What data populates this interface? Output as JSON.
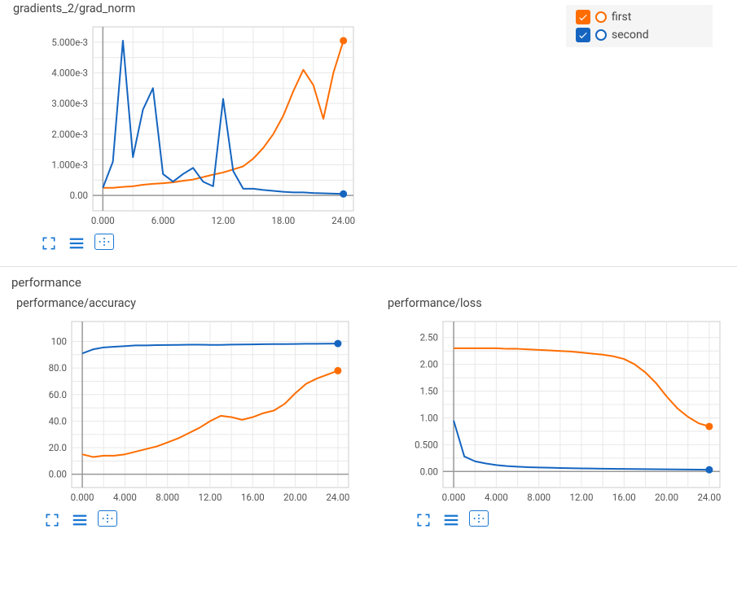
{
  "legend": {
    "items": [
      {
        "label": "first",
        "color": "#ff6d00"
      },
      {
        "label": "second",
        "color": "#1565c0"
      }
    ]
  },
  "section2_title": "performance",
  "chart_data": [
    {
      "id": "grad",
      "title": "gradients_2/grad_norm",
      "type": "line",
      "xlim": [
        -1,
        25
      ],
      "ylim": [
        -0.0005,
        0.0055
      ],
      "xticks_raw": [
        0,
        6,
        12,
        18,
        24
      ],
      "xticks_label": [
        "0.000",
        "6.000",
        "12.00",
        "18.00",
        "24.00"
      ],
      "yticks_raw": [
        0,
        0.001,
        0.002,
        0.003,
        0.004,
        0.005
      ],
      "yticks_label": [
        "0.00",
        "1.000e-3",
        "2.000e-3",
        "3.000e-3",
        "4.000e-3",
        "5.000e-3"
      ],
      "x": [
        0,
        1,
        2,
        3,
        4,
        5,
        6,
        7,
        8,
        9,
        10,
        11,
        12,
        13,
        14,
        15,
        16,
        17,
        18,
        19,
        20,
        21,
        22,
        23,
        24
      ],
      "series": [
        {
          "name": "first",
          "color": "#ff6d00",
          "values": [
            0.00025,
            0.00025,
            0.00028,
            0.0003,
            0.00035,
            0.00038,
            0.0004,
            0.00043,
            0.00048,
            0.00052,
            0.0006,
            0.00068,
            0.00075,
            0.00085,
            0.00095,
            0.0012,
            0.00155,
            0.002,
            0.0026,
            0.0034,
            0.0041,
            0.0036,
            0.0025,
            0.004,
            0.00505
          ]
        },
        {
          "name": "second",
          "color": "#1565c0",
          "values": [
            0.00025,
            0.0011,
            0.00505,
            0.00125,
            0.0028,
            0.0035,
            0.0007,
            0.00045,
            0.0007,
            0.0009,
            0.00045,
            0.0003,
            0.00315,
            0.0008,
            0.00022,
            0.00022,
            0.00018,
            0.00015,
            0.00012,
            0.0001,
            0.0001,
            8e-05,
            7e-05,
            6e-05,
            5e-05
          ]
        }
      ]
    },
    {
      "id": "acc",
      "title": "performance/accuracy",
      "type": "line",
      "xlim": [
        -1,
        25
      ],
      "ylim": [
        -10,
        115
      ],
      "xticks_raw": [
        0,
        4,
        8,
        12,
        16,
        20,
        24
      ],
      "xticks_label": [
        "0.000",
        "4.000",
        "8.000",
        "12.00",
        "16.00",
        "20.00",
        "24.00"
      ],
      "yticks_raw": [
        0,
        20,
        40,
        60,
        80,
        100
      ],
      "yticks_label": [
        "0.00",
        "20.0",
        "40.0",
        "60.0",
        "80.0",
        "100"
      ],
      "x": [
        0,
        1,
        2,
        3,
        4,
        5,
        6,
        7,
        8,
        9,
        10,
        11,
        12,
        13,
        14,
        15,
        16,
        17,
        18,
        19,
        20,
        21,
        22,
        23,
        24
      ],
      "series": [
        {
          "name": "first",
          "color": "#ff6d00",
          "values": [
            15,
            13,
            14,
            14,
            15,
            17,
            19,
            21,
            24,
            27,
            31,
            35,
            40,
            44,
            43,
            41,
            43,
            46,
            48,
            53,
            61,
            68,
            72,
            75,
            78
          ]
        },
        {
          "name": "second",
          "color": "#1565c0",
          "values": [
            91,
            94,
            95.5,
            96,
            96.5,
            97,
            97,
            97.2,
            97.3,
            97.4,
            97.5,
            97.5,
            97.4,
            97.4,
            97.6,
            97.7,
            97.8,
            97.9,
            98,
            98,
            98.1,
            98.2,
            98.2,
            98.3,
            98.4
          ]
        }
      ]
    },
    {
      "id": "loss",
      "title": "performance/loss",
      "type": "line",
      "xlim": [
        -1,
        25
      ],
      "ylim": [
        -0.3,
        2.8
      ],
      "xticks_raw": [
        0,
        4,
        8,
        12,
        16,
        20,
        24
      ],
      "xticks_label": [
        "0.000",
        "4.000",
        "8.000",
        "12.00",
        "16.00",
        "20.00",
        "24.00"
      ],
      "yticks_raw": [
        0,
        0.5,
        1.0,
        1.5,
        2.0,
        2.5
      ],
      "yticks_label": [
        "0.00",
        "0.500",
        "1.00",
        "1.50",
        "2.00",
        "2.50"
      ],
      "x": [
        0,
        1,
        2,
        3,
        4,
        5,
        6,
        7,
        8,
        9,
        10,
        11,
        12,
        13,
        14,
        15,
        16,
        17,
        18,
        19,
        20,
        21,
        22,
        23,
        24
      ],
      "series": [
        {
          "name": "first",
          "color": "#ff6d00",
          "values": [
            2.3,
            2.3,
            2.3,
            2.3,
            2.3,
            2.29,
            2.29,
            2.28,
            2.27,
            2.26,
            2.25,
            2.24,
            2.22,
            2.2,
            2.18,
            2.15,
            2.1,
            2.0,
            1.85,
            1.65,
            1.4,
            1.18,
            1.02,
            0.9,
            0.84
          ]
        },
        {
          "name": "second",
          "color": "#1565c0",
          "values": [
            0.95,
            0.28,
            0.19,
            0.15,
            0.12,
            0.1,
            0.09,
            0.08,
            0.075,
            0.07,
            0.065,
            0.06,
            0.058,
            0.055,
            0.052,
            0.05,
            0.048,
            0.046,
            0.044,
            0.042,
            0.04,
            0.038,
            0.036,
            0.034,
            0.032
          ]
        }
      ]
    }
  ]
}
